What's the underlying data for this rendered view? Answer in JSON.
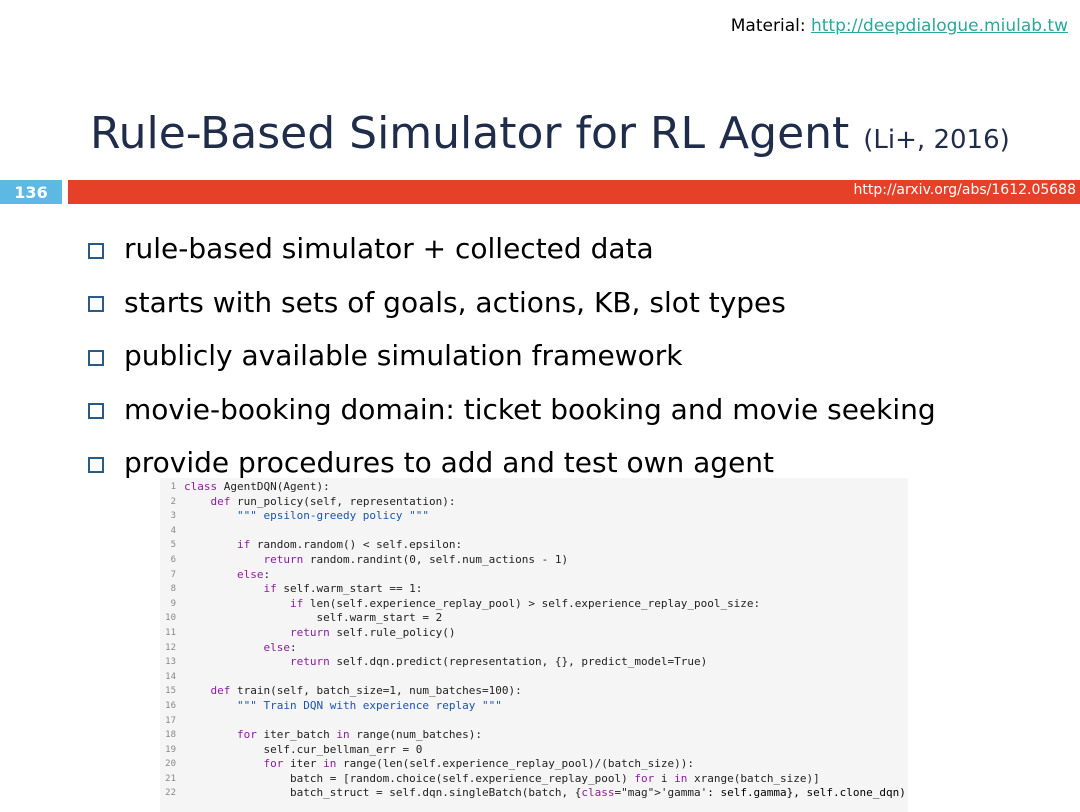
{
  "header": {
    "material_label": "Material:",
    "material_link": "http://deepdialogue.miulab.tw"
  },
  "title": {
    "main": "Rule-Based Simulator for RL Agent",
    "citation": "(Li+, 2016)"
  },
  "slide_number": "136",
  "reference_url": "http://arxiv.org/abs/1612.05688",
  "bullets": [
    "rule-based simulator + collected data",
    "starts with sets of goals, actions, KB, slot types",
    "publicly available simulation framework",
    "movie-booking domain: ticket booking and movie seeking",
    "provide procedures to add and test own agent"
  ],
  "code_lines": [
    "class AgentDQN(Agent):",
    "    def run_policy(self, representation):",
    "        \"\"\" epsilon-greedy policy \"\"\"",
    "",
    "        if random.random() < self.epsilon:",
    "            return random.randint(0, self.num_actions - 1)",
    "        else:",
    "            if self.warm_start == 1:",
    "                if len(self.experience_replay_pool) > self.experience_replay_pool_size:",
    "                    self.warm_start = 2",
    "                return self.rule_policy()",
    "            else:",
    "                return self.dqn.predict(representation, {}, predict_model=True)",
    "",
    "    def train(self, batch_size=1, num_batches=100):",
    "        \"\"\" Train DQN with experience replay \"\"\"",
    "",
    "        for iter_batch in range(num_batches):",
    "            self.cur_bellman_err = 0",
    "            for iter in range(len(self.experience_replay_pool)/(batch_size)):",
    "                batch = [random.choice(self.experience_replay_pool) for i in xrange(batch_size)]",
    "                batch_struct = self.dqn.singleBatch(batch, {'gamma': self.gamma}, self.clone_dqn)"
  ]
}
